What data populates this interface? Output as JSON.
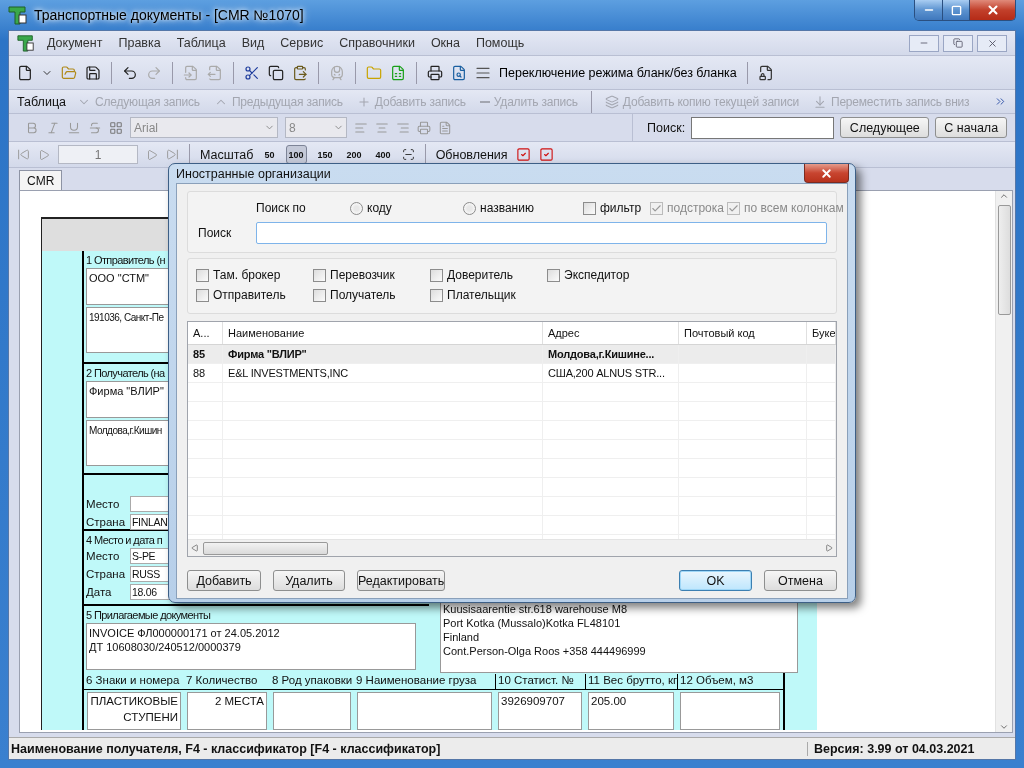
{
  "window": {
    "title": "Транспортные документы - [CMR №1070]"
  },
  "menu": [
    "Документ",
    "Правка",
    "Таблица",
    "Вид",
    "Сервис",
    "Справочники",
    "Окна",
    "Помощь"
  ],
  "toolbar": {
    "mode_switch": "Переключение режима бланк/без бланка"
  },
  "table_toolbar": {
    "title": "Таблица",
    "actions": [
      {
        "kind": "next",
        "label": "Следующая запись",
        "disabled": true
      },
      {
        "kind": "prev",
        "label": "Предыдущая запись",
        "disabled": true
      },
      {
        "kind": "add",
        "label": "Добавить запись",
        "disabled": true
      },
      {
        "kind": "delete",
        "label": "Удалить запись",
        "disabled": true
      },
      {
        "kind": "copy",
        "label": "Добавить копию текущей записи",
        "disabled": true
      },
      {
        "kind": "move",
        "label": "Переместить запись вниз",
        "disabled": true
      }
    ]
  },
  "format_bar": {
    "font": "Arial",
    "size": "8"
  },
  "search": {
    "label": "Поиск:",
    "buttons": [
      "Следующее",
      "С начала"
    ]
  },
  "navigation": {
    "page": "1"
  },
  "zoom": {
    "label": "Масштаб",
    "levels": [
      {
        "label": "50",
        "selected": false
      },
      {
        "label": "100",
        "selected": true
      },
      {
        "label": "150",
        "selected": false
      },
      {
        "label": "200",
        "selected": false
      },
      {
        "label": "400",
        "selected": false
      }
    ]
  },
  "updates": {
    "label": "Обновления"
  },
  "doc_tabs": [
    {
      "label": "CMR",
      "selected": true
    }
  ],
  "form": {
    "sender": {
      "label": "1 Отправитель (н",
      "name": "ООО \"СТМ\"",
      "address": "191036, Санкт-Пе"
    },
    "consignee": {
      "label": "2 Получатель (на",
      "name": "Фирма \"ВЛИР\"",
      "address": "Молдова,г.Кишин"
    },
    "delivery": [
      {
        "label": "Место"
      },
      {
        "label": "Страна",
        "value": "FINLAN"
      }
    ],
    "loading": {
      "label": "4 Место и дата п",
      "fields": [
        {
          "label": "Место",
          "value": "S-PE"
        },
        {
          "label": "Страна",
          "value": "RUSS"
        },
        {
          "label": "Дата",
          "value": "18.06"
        }
      ]
    },
    "documents": {
      "label": "5 Прилагаемые документы",
      "lines": [
        "INVOICE ФЛ000000171 от 24.05.2012",
        "ДТ 10608030/240512/0000379"
      ]
    },
    "carrier_address": [
      "Kuusisaarentie str.618 warehouse M8",
      "Port Kotka (Mussalo)Kotka FL48101",
      "Finland",
      "Cont.Person-Olga Roos +358 444496999"
    ],
    "cargo": [
      {
        "label": "6 Знаки и номера",
        "value": "ПЛАСТИКОВЫЕСТУПЕНИ"
      },
      {
        "label": "7 Количество",
        "value": "2 МЕСТА"
      },
      {
        "label": "8 Род упаковки"
      },
      {
        "label": "9 Наименование груза"
      },
      {
        "label": "10 Статист. №",
        "value": "3926909707"
      },
      {
        "label": "11 Вес брутто, кг",
        "value": "205.00"
      },
      {
        "label": "12 Объем, м3"
      }
    ]
  },
  "dialog": {
    "title": "Иностранные организации",
    "search_by": {
      "label": "Поиск по",
      "options": [
        {
          "label": "коду",
          "selected": false
        },
        {
          "label": "названию",
          "selected": false
        }
      ]
    },
    "flags": [
      {
        "label": "фильтр",
        "checked": false,
        "disabled": false
      },
      {
        "label": "подстрока",
        "checked": true,
        "disabled": true
      },
      {
        "label": "по всем колонкам",
        "checked": true,
        "disabled": true
      }
    ],
    "search_label": "Поиск",
    "roles": [
      {
        "label": "Там. брокер",
        "checked": false
      },
      {
        "label": "Перевозчик",
        "checked": false
      },
      {
        "label": "Доверитель",
        "checked": false
      },
      {
        "label": "Экспедитор",
        "checked": false
      },
      {
        "label": "Отправитель",
        "checked": false
      },
      {
        "label": "Получатель",
        "checked": false
      },
      {
        "label": "Плательщик",
        "checked": false
      }
    ],
    "columns": [
      "А...",
      "Наименование",
      "Адрес",
      "Почтовый код",
      "Буке"
    ],
    "rows": [
      {
        "cells": [
          "85",
          "Фирма \"ВЛИР\"",
          "Молдова,г.Кишине..."
        ],
        "selected": true
      },
      {
        "cells": [
          "88",
          "E&L INVESTMENTS,INC",
          "США,200 ALNUS STR..."
        ],
        "selected": false
      }
    ],
    "left_buttons": [
      "Добавить",
      "Удалить",
      "Редактировать"
    ],
    "right_buttons": [
      {
        "label": "OK",
        "default": true
      },
      {
        "label": "Отмена",
        "default": false
      }
    ]
  },
  "status_bar": {
    "hint": "Наименование получателя, F4 - классификатор [F4 - классификатор]",
    "version": "Версия: 3.99 от 04.03.2021"
  }
}
